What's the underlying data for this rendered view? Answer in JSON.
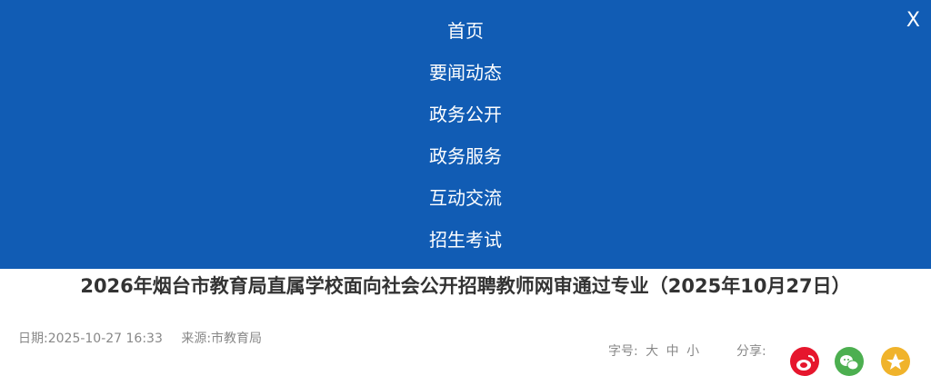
{
  "nav": {
    "items": [
      {
        "label": "首页"
      },
      {
        "label": "要闻动态"
      },
      {
        "label": "政务公开"
      },
      {
        "label": "政务服务"
      },
      {
        "label": "互动交流"
      },
      {
        "label": "招生考试"
      }
    ],
    "close_label": "X"
  },
  "article": {
    "title": "2026年烟台市教育局直属学校面向社会公开招聘教师网审通过专业（2025年10月27日）",
    "date": "日期:2025-10-27 16:33",
    "source": "来源:市教育局"
  },
  "font_size": {
    "label": "字号:",
    "options": [
      "大",
      "中",
      "小"
    ]
  },
  "share": {
    "label": "分享:",
    "icons": [
      "weibo-icon",
      "wechat-icon",
      "qzone-icon"
    ]
  },
  "colors": {
    "nav_background": "#115cb4",
    "title_text": "#333333",
    "meta_text": "#888888",
    "weibo": "#e6162d",
    "wechat": "#4caf50",
    "qzone": "#f0b32b"
  }
}
